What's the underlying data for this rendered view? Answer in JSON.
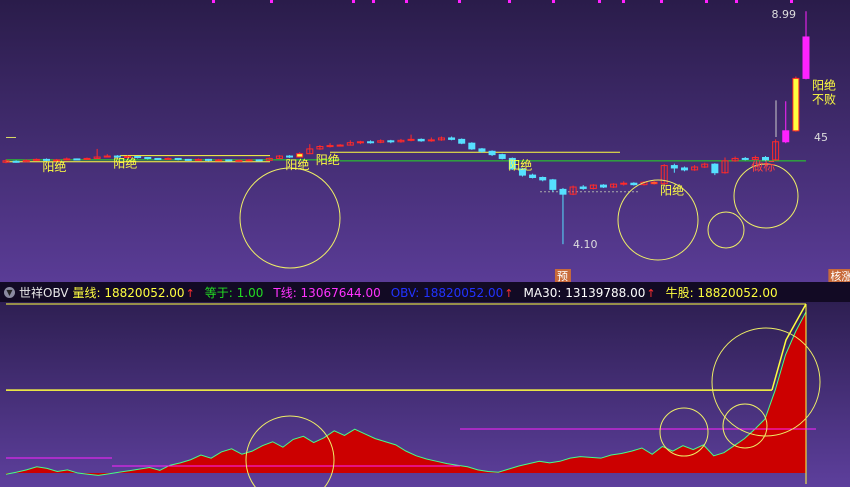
{
  "colors": {
    "bg_top": "#2a1c4a",
    "bg_bottom": "#5a3c96",
    "up": "#ff2a2a",
    "down": "#56e0ff",
    "yellow": "#ffff40",
    "green": "#22dd22",
    "magenta": "#ff22ff",
    "obv_fill": "#cc0000",
    "circle": "#eeee66"
  },
  "indicator_bar": {
    "name": "世祥OBV",
    "items": [
      {
        "label": "量线: 18820052.00",
        "color": "#ffff40",
        "arrow": "↑",
        "arrow_color": "#ff3030"
      },
      {
        "label": "等于: 1.00",
        "color": "#22dd22",
        "arrow": "",
        "arrow_color": ""
      },
      {
        "label": "T线: 13067644.00",
        "color": "#ff33ff",
        "arrow": "",
        "arrow_color": ""
      },
      {
        "label": "OBV: 18820052.00",
        "color": "#2233ff",
        "arrow": "↑",
        "arrow_color": "#ff3030"
      },
      {
        "label": "MA30: 13139788.00",
        "color": "#ffffff",
        "arrow": "↑",
        "arrow_color": "#ff3030"
      },
      {
        "label": "牛股: 18820052.00",
        "color": "#ffff40",
        "arrow": "",
        "arrow_color": ""
      }
    ]
  },
  "chart_data": [
    {
      "type": "candlestick",
      "price_labels": {
        "high": "8.99",
        "low": "4.10",
        "level": "45"
      },
      "ylim": [
        3.6,
        9.1
      ],
      "candles": [
        {
          "o": 5.82,
          "c": 5.85,
          "h": 5.88,
          "l": 5.8
        },
        {
          "o": 5.84,
          "c": 5.83,
          "h": 5.86,
          "l": 5.81
        },
        {
          "o": 5.83,
          "c": 5.86,
          "h": 5.88,
          "l": 5.82
        },
        {
          "o": 5.86,
          "c": 5.88,
          "h": 5.9,
          "l": 5.85
        },
        {
          "o": 5.88,
          "c": 5.86,
          "h": 5.9,
          "l": 5.84
        },
        {
          "o": 5.86,
          "c": 5.87,
          "h": 5.89,
          "l": 5.85
        },
        {
          "o": 5.87,
          "c": 5.89,
          "h": 5.92,
          "l": 5.86
        },
        {
          "o": 5.89,
          "c": 5.88,
          "h": 5.9,
          "l": 5.87
        },
        {
          "o": 5.88,
          "c": 5.9,
          "h": 5.92,
          "l": 5.87
        },
        {
          "o": 5.9,
          "c": 5.93,
          "h": 6.1,
          "l": 5.89
        },
        {
          "o": 5.93,
          "c": 5.95,
          "h": 5.99,
          "l": 5.92
        },
        {
          "o": 5.95,
          "c": 5.93,
          "h": 5.97,
          "l": 5.91
        },
        {
          "o": 5.93,
          "c": 5.94,
          "h": 5.96,
          "l": 5.91
        },
        {
          "o": 5.94,
          "c": 5.92,
          "h": 5.95,
          "l": 5.9
        },
        {
          "o": 5.92,
          "c": 5.9,
          "h": 5.93,
          "l": 5.88
        },
        {
          "o": 5.9,
          "c": 5.89,
          "h": 5.91,
          "l": 5.87
        },
        {
          "o": 5.89,
          "c": 5.9,
          "h": 5.92,
          "l": 5.88
        },
        {
          "o": 5.9,
          "c": 5.88,
          "h": 5.91,
          "l": 5.86
        },
        {
          "o": 5.88,
          "c": 5.87,
          "h": 5.89,
          "l": 5.85
        },
        {
          "o": 5.87,
          "c": 5.88,
          "h": 5.9,
          "l": 5.86
        },
        {
          "o": 5.88,
          "c": 5.86,
          "h": 5.89,
          "l": 5.84
        },
        {
          "o": 5.86,
          "c": 5.87,
          "h": 5.89,
          "l": 5.85
        },
        {
          "o": 5.87,
          "c": 5.85,
          "h": 5.88,
          "l": 5.84
        },
        {
          "o": 5.85,
          "c": 5.86,
          "h": 5.88,
          "l": 5.84
        },
        {
          "o": 5.86,
          "c": 5.87,
          "h": 5.89,
          "l": 5.85
        },
        {
          "o": 5.87,
          "c": 5.86,
          "h": 5.88,
          "l": 5.85
        },
        {
          "o": 5.86,
          "c": 5.9,
          "h": 5.92,
          "l": 5.85
        },
        {
          "o": 5.9,
          "c": 5.95,
          "h": 5.97,
          "l": 5.89
        },
        {
          "o": 5.95,
          "c": 5.93,
          "h": 5.97,
          "l": 5.91
        },
        {
          "o": 5.93,
          "c": 6.0,
          "h": 6.03,
          "l": 5.92
        },
        {
          "o": 6.0,
          "c": 6.1,
          "h": 6.2,
          "l": 5.99
        },
        {
          "o": 6.1,
          "c": 6.15,
          "h": 6.18,
          "l": 6.08
        },
        {
          "o": 6.15,
          "c": 6.17,
          "h": 6.22,
          "l": 6.13
        },
        {
          "o": 6.17,
          "c": 6.18,
          "h": 6.2,
          "l": 6.15
        },
        {
          "o": 6.18,
          "c": 6.23,
          "h": 6.28,
          "l": 6.17
        },
        {
          "o": 6.23,
          "c": 6.25,
          "h": 6.27,
          "l": 6.2
        },
        {
          "o": 6.25,
          "c": 6.24,
          "h": 6.28,
          "l": 6.21
        },
        {
          "o": 6.24,
          "c": 6.27,
          "h": 6.3,
          "l": 6.22
        },
        {
          "o": 6.27,
          "c": 6.25,
          "h": 6.29,
          "l": 6.22
        },
        {
          "o": 6.25,
          "c": 6.28,
          "h": 6.31,
          "l": 6.23
        },
        {
          "o": 6.28,
          "c": 6.3,
          "h": 6.4,
          "l": 6.26
        },
        {
          "o": 6.3,
          "c": 6.27,
          "h": 6.32,
          "l": 6.25
        },
        {
          "o": 6.27,
          "c": 6.29,
          "h": 6.34,
          "l": 6.25
        },
        {
          "o": 6.29,
          "c": 6.33,
          "h": 6.36,
          "l": 6.27
        },
        {
          "o": 6.33,
          "c": 6.3,
          "h": 6.36,
          "l": 6.28
        },
        {
          "o": 6.3,
          "c": 6.22,
          "h": 6.32,
          "l": 6.2
        },
        {
          "o": 6.22,
          "c": 6.1,
          "h": 6.24,
          "l": 6.08
        },
        {
          "o": 6.1,
          "c": 6.05,
          "h": 6.12,
          "l": 6.02
        },
        {
          "o": 6.05,
          "c": 5.98,
          "h": 6.07,
          "l": 5.95
        },
        {
          "o": 5.98,
          "c": 5.9,
          "h": 6.0,
          "l": 5.88
        },
        {
          "o": 5.9,
          "c": 5.68,
          "h": 5.92,
          "l": 5.66
        },
        {
          "o": 5.68,
          "c": 5.55,
          "h": 5.7,
          "l": 5.52
        },
        {
          "o": 5.55,
          "c": 5.5,
          "h": 5.58,
          "l": 5.48
        },
        {
          "o": 5.5,
          "c": 5.45,
          "h": 5.52,
          "l": 5.42
        },
        {
          "o": 5.45,
          "c": 5.25,
          "h": 5.47,
          "l": 5.2
        },
        {
          "o": 5.25,
          "c": 5.15,
          "h": 5.28,
          "l": 4.1
        },
        {
          "o": 5.15,
          "c": 5.3,
          "h": 5.33,
          "l": 5.13
        },
        {
          "o": 5.3,
          "c": 5.27,
          "h": 5.34,
          "l": 5.24
        },
        {
          "o": 5.27,
          "c": 5.34,
          "h": 5.36,
          "l": 5.25
        },
        {
          "o": 5.34,
          "c": 5.3,
          "h": 5.36,
          "l": 5.28
        },
        {
          "o": 5.3,
          "c": 5.36,
          "h": 5.38,
          "l": 5.28
        },
        {
          "o": 5.36,
          "c": 5.38,
          "h": 5.42,
          "l": 5.33
        },
        {
          "o": 5.38,
          "c": 5.35,
          "h": 5.4,
          "l": 5.33
        },
        {
          "o": 5.35,
          "c": 5.4,
          "h": 5.42,
          "l": 5.33
        },
        {
          "o": 5.4,
          "c": 5.37,
          "h": 5.43,
          "l": 5.35
        },
        {
          "o": 5.37,
          "c": 5.75,
          "h": 5.78,
          "l": 5.35
        },
        {
          "o": 5.75,
          "c": 5.7,
          "h": 5.79,
          "l": 5.6
        },
        {
          "o": 5.7,
          "c": 5.66,
          "h": 5.73,
          "l": 5.63
        },
        {
          "o": 5.66,
          "c": 5.72,
          "h": 5.76,
          "l": 5.64
        },
        {
          "o": 5.72,
          "c": 5.78,
          "h": 5.81,
          "l": 5.7
        },
        {
          "o": 5.78,
          "c": 5.6,
          "h": 5.8,
          "l": 5.55
        },
        {
          "o": 5.6,
          "c": 5.85,
          "h": 5.92,
          "l": 5.58
        },
        {
          "o": 5.85,
          "c": 5.9,
          "h": 5.94,
          "l": 5.83
        },
        {
          "o": 5.9,
          "c": 5.88,
          "h": 5.93,
          "l": 5.86
        },
        {
          "o": 5.88,
          "c": 5.92,
          "h": 5.96,
          "l": 5.87
        },
        {
          "o": 5.92,
          "c": 5.87,
          "h": 5.95,
          "l": 5.84
        },
        {
          "o": 5.87,
          "c": 6.25,
          "h": 6.3,
          "l": 5.85
        },
        {
          "o": 6.25,
          "c": 6.48,
          "h": 7.1,
          "l": 6.22
        },
        {
          "o": 6.48,
          "c": 7.58,
          "h": 7.62,
          "l": 6.46
        },
        {
          "o": 7.58,
          "c": 8.45,
          "h": 8.99,
          "l": 7.56
        }
      ],
      "annotations": [
        {
          "text": "阳绝",
          "i": 3
        },
        {
          "text": "阳绝",
          "i": 10
        },
        {
          "text": "阳绝",
          "i": 27
        },
        {
          "text": "阳绝",
          "i": 30
        },
        {
          "text": "阳绝",
          "i": 49
        },
        {
          "text": "阳绝",
          "i": 64
        },
        {
          "text": "阳绝",
          "i": 79
        },
        {
          "text": "不败",
          "i": 79
        },
        {
          "text": "做标",
          "i": 73
        }
      ],
      "markers": [
        {
          "text": "预",
          "i": 55
        },
        {
          "text": "核涨",
          "i": 82
        }
      ]
    },
    {
      "type": "area",
      "series": [
        {
          "values": [
            0.5,
            1.0,
            1.6,
            2.4,
            2.0,
            1.2,
            1.6,
            0.8,
            0.5,
            0.2,
            0.6,
            1.0,
            1.4,
            1.8,
            2.2,
            1.5,
            2.8,
            3.4,
            4.2,
            5.4,
            4.6,
            6.2,
            7.0,
            5.6,
            6.4,
            7.8,
            8.8,
            7.4,
            9.4,
            10.2,
            8.6,
            9.8,
            11.6,
            10.4,
            12.0,
            10.8,
            9.6,
            8.8,
            8.0,
            6.4,
            5.2,
            4.4,
            3.8,
            3.2,
            2.8,
            2.4,
            1.6,
            1.2,
            1.0,
            1.8,
            2.6,
            3.2,
            3.8,
            3.4,
            3.8,
            4.6,
            5.0,
            4.8,
            4.6,
            5.4,
            5.8,
            6.4,
            7.2,
            5.6,
            7.6,
            6.4,
            7.8,
            6.8,
            8.0,
            5.2,
            6.0,
            7.8,
            9.6,
            12.0,
            14.6,
            22.0,
            31.0,
            37.0,
            42.0
          ]
        }
      ],
      "ma_yellow": 22.0,
      "ylim": [
        -2,
        44
      ]
    }
  ]
}
